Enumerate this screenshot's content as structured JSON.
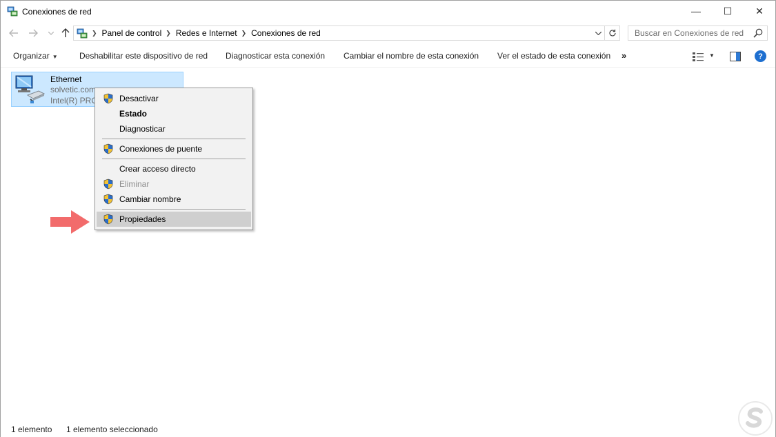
{
  "window": {
    "title": "Conexiones de red",
    "buttons": {
      "minimize": "—",
      "maximize": "☐",
      "close": "✕"
    }
  },
  "nav": {
    "back_icon": "arrow-left-icon",
    "forward_icon": "arrow-right-icon",
    "up_icon": "arrow-up-icon",
    "breadcrumbs": [
      "Panel de control",
      "Redes e Internet",
      "Conexiones de red"
    ],
    "search_placeholder": "Buscar en Conexiones de red"
  },
  "commandbar": {
    "organize": "Organizar",
    "disable": "Deshabilitar este dispositivo de red",
    "diagnose": "Diagnosticar esta conexión",
    "rename": "Cambiar el nombre de esta conexión",
    "status": "Ver el estado de esta conexión",
    "more": "»",
    "help": "?"
  },
  "connection": {
    "name": "Ethernet",
    "network": "solvetic.com",
    "adapter": "Intel(R) PRO"
  },
  "context_menu": {
    "items": [
      {
        "label": "Desactivar",
        "shield": true,
        "bold": false,
        "disabled": false
      },
      {
        "label": "Estado",
        "shield": false,
        "bold": true,
        "disabled": false
      },
      {
        "label": "Diagnosticar",
        "shield": false,
        "bold": false,
        "disabled": false
      },
      {
        "label": "Conexiones de puente",
        "shield": true,
        "bold": false,
        "disabled": false
      },
      {
        "label": "Crear acceso directo",
        "shield": false,
        "bold": false,
        "disabled": false
      },
      {
        "label": "Eliminar",
        "shield": true,
        "bold": false,
        "disabled": true
      },
      {
        "label": "Cambiar nombre",
        "shield": true,
        "bold": false,
        "disabled": false
      },
      {
        "label": "Propiedades",
        "shield": true,
        "bold": false,
        "disabled": false,
        "highlighted": true
      }
    ]
  },
  "statusbar": {
    "count": "1 elemento",
    "selected": "1 elemento seleccionado"
  },
  "colors": {
    "selection_bg": "#cce8ff",
    "selection_border": "#99d1ff",
    "menu_bg": "#f2f2f2",
    "menu_highlight": "#cfcfcf",
    "annotation_arrow": "#f26b6b",
    "help_blue": "#1e6fd0"
  }
}
